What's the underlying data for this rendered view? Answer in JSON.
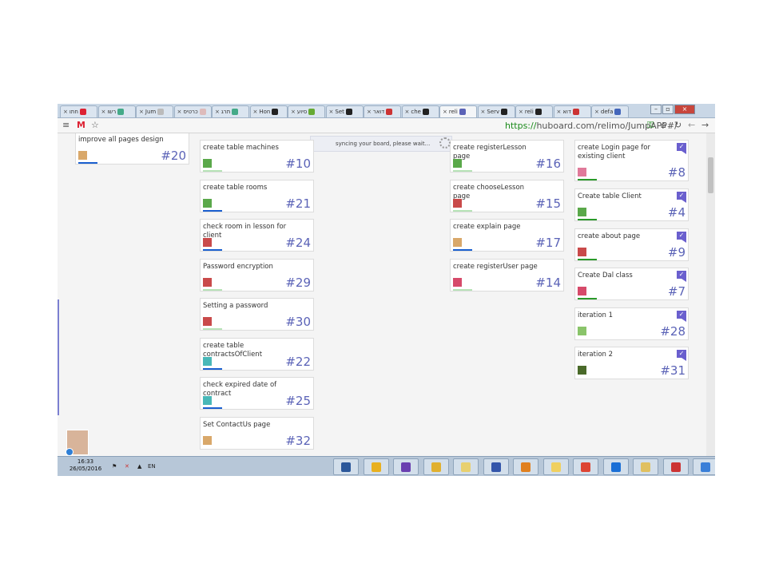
{
  "browser": {
    "tabs": [
      {
        "label": "חתו",
        "fav": "#d23"
      },
      {
        "label": "רשו",
        "fav": "#4a8"
      },
      {
        "label": "Jum",
        "fav": "#bbb"
      },
      {
        "label": "כרטיס",
        "fav": "#dbb"
      },
      {
        "label": "תרג",
        "fav": "#4a8"
      },
      {
        "label": "Hon",
        "fav": "#222"
      },
      {
        "label": "סיוע",
        "fav": "#6a3"
      },
      {
        "label": "Set",
        "fav": "#222"
      },
      {
        "label": "דואר",
        "fav": "#c33"
      },
      {
        "label": "che",
        "fav": "#222"
      },
      {
        "label": "reli",
        "fav": "#5b63b7"
      },
      {
        "label": "Serv",
        "fav": "#222"
      },
      {
        "label": "reli",
        "fav": "#222"
      },
      {
        "label": "דוא",
        "fav": "#c33"
      },
      {
        "label": "defa",
        "fav": "#4466bb"
      }
    ],
    "url_scheme": "https://",
    "url_rest": "huboard.com/relimo/JumpAPP#/",
    "gmail_letter": "M",
    "star": "☆",
    "menu": "≡"
  },
  "board": {
    "sync_message": "syncing your board, please wait...",
    "columns": [
      {
        "cards": [
          {
            "title": "improve all pages design",
            "number": "#20",
            "bar": "#1a5fcf",
            "avatar": "#d9a86a"
          }
        ]
      },
      {
        "cards": [
          {
            "title": "create table machines",
            "number": "#10",
            "bar": "#b7e3b7",
            "avatar": "#5aa84a"
          },
          {
            "title": "create table rooms",
            "number": "#21",
            "bar": "#1a5fcf",
            "avatar": "#5aa84a"
          },
          {
            "title": "check room in lesson for client",
            "number": "#24",
            "bar": "#1a5fcf",
            "avatar": "#c94a4a"
          },
          {
            "title": "Password encryption",
            "number": "#29",
            "bar": "#b7e3b7",
            "avatar": "#c94a4a"
          },
          {
            "title": "Setting a password",
            "number": "#30",
            "bar": "#b7e3b7",
            "avatar": "#c94a4a"
          },
          {
            "title": "create table contractsOfClient",
            "number": "#22",
            "bar": "#1a5fcf",
            "avatar": "#49b8b8"
          },
          {
            "title": "check expired date of contract",
            "number": "#25",
            "bar": "#1a5fcf",
            "avatar": "#49b8b8"
          },
          {
            "title": "Set ContactUs page",
            "number": "#32",
            "bar": "#ffffff",
            "avatar": "#d9a86a"
          }
        ]
      },
      {
        "cards": [
          {
            "title": "create registerLesson page",
            "number": "#16",
            "bar": "#b7e3b7",
            "avatar": "#5aa84a"
          },
          {
            "title": "create chooseLesson page",
            "number": "#15",
            "bar": "#b7e3b7",
            "avatar": "#c94a4a"
          },
          {
            "title": "create explain page",
            "number": "#17",
            "bar": "#1a5fcf",
            "avatar": "#d9a86a"
          },
          {
            "title": "create registerUser page",
            "number": "#14",
            "bar": "#b7e3b7",
            "avatar": "#d64a6a"
          }
        ]
      },
      {
        "cards": [
          {
            "title": "create Login page for existing client",
            "number": "#8",
            "bar": "#2a9a2a",
            "avatar": "#e07a9a"
          },
          {
            "title": "Create table Client",
            "number": "#4",
            "bar": "#2a9a2a",
            "avatar": "#5aa84a"
          },
          {
            "title": "create about page",
            "number": "#9",
            "bar": "#2a9a2a",
            "avatar": "#c94a4a"
          },
          {
            "title": "Create Dal class",
            "number": "#7",
            "bar": "#2a9a2a",
            "avatar": "#d64a6a"
          },
          {
            "title": "iteration 1",
            "number": "#28",
            "bar": "#ffffff",
            "avatar": "#8ac46a"
          },
          {
            "title": "iteration 2",
            "number": "#31",
            "bar": "#ffffff",
            "avatar": "#4a6a2a"
          }
        ]
      }
    ],
    "check_glyph": "✓"
  },
  "taskbar": {
    "time": "16:33",
    "date": "26/05/2016",
    "lang": "EN",
    "apps": [
      "#2b579a",
      "#e8b020",
      "#6a3fb0",
      "#e0b030",
      "#e8d070",
      "#3355aa",
      "#e08020",
      "#f0d060",
      "#dd4433",
      "#1a6fd6",
      "#e0c060",
      "#cc3333",
      "#3a7fd8"
    ]
  }
}
